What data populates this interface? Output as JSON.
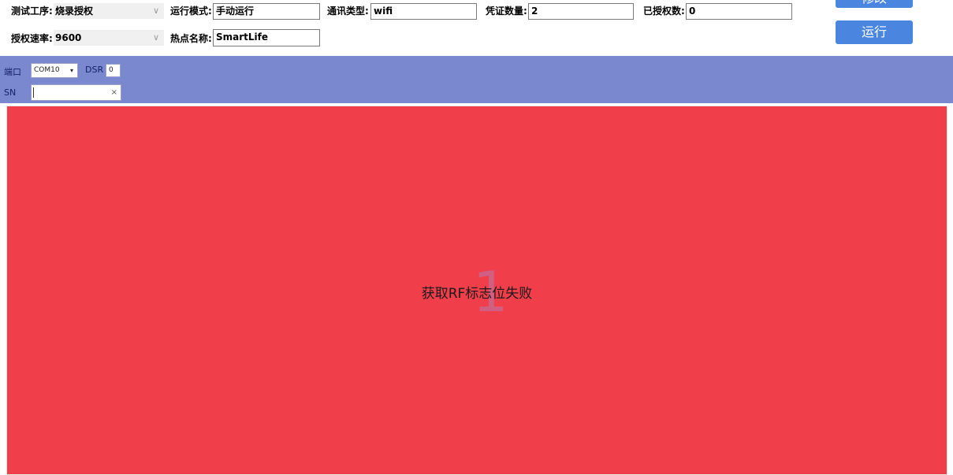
{
  "config": {
    "test_process_label": "测试工序:",
    "test_process_value": "烧录授权",
    "run_mode_label": "运行模式:",
    "run_mode_value": "手动运行",
    "comm_type_label": "通讯类型:",
    "comm_type_value": "wifi",
    "credential_count_label": "凭证数量:",
    "credential_count_value": "2",
    "authorized_count_label": "已授权数:",
    "authorized_count_value": "0",
    "auth_rate_label": "授权速率:",
    "auth_rate_value": "9600",
    "hotspot_name_label": "热点名称:",
    "hotspot_name_value": "SmartLife"
  },
  "buttons": {
    "modify_label": "修改",
    "run_label": "运行"
  },
  "port": {
    "port_label": "端口",
    "port_value": "COM10",
    "dsr_label": "DSR",
    "dsr_value": "0",
    "sn_label": "SN",
    "sn_value": "",
    "clear_symbol": "×"
  },
  "result": {
    "index": "1",
    "message": "获取RF标志位失败",
    "background_color": "#f03e4a"
  },
  "icons": {
    "dropdown": "chevron-down-icon",
    "clear": "close-icon"
  }
}
